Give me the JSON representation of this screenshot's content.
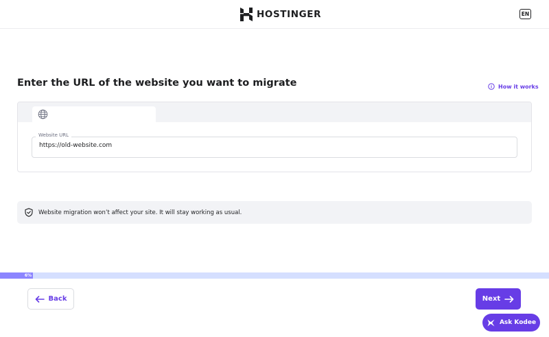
{
  "header": {
    "logo_text": "HOSTINGER",
    "lang_label": "EN"
  },
  "main": {
    "title": "Enter the URL of the website you want to migrate",
    "how_it_works": "How it works",
    "url_label": "Website URL",
    "url_value": "https://old-website.com",
    "notice": "Website migration won’t affect your site. It will stay working as usual."
  },
  "progress": {
    "value_percent": 6,
    "label": "6%"
  },
  "footer": {
    "back_label": "Back",
    "next_label": "Next",
    "kodee_label": "Ask Kodee"
  },
  "colors": {
    "brand": "#673de6",
    "progress_fill": "#8c85ff",
    "progress_track": "#d5dfff",
    "notice_bg": "#f2f3f6"
  }
}
